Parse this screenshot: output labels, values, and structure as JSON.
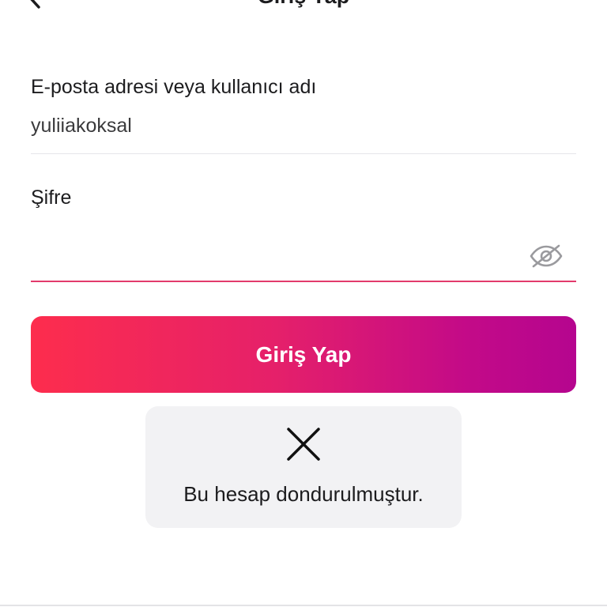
{
  "header": {
    "title": "Giriş Yap",
    "back_icon": "chevron-left-icon"
  },
  "form": {
    "email_label": "E-posta adresi veya kullanıcı adı",
    "email_value": "yuliiakoksal",
    "password_label": "Şifre",
    "password_value": "",
    "password_toggle_icon": "eye-slash-icon"
  },
  "login_button": {
    "label": "Giriş Yap",
    "gradient_start": "#fd2d4d",
    "gradient_end": "#b5058f"
  },
  "toast": {
    "icon": "close-icon",
    "message": "Bu hesap dondurulmuştur."
  },
  "colors": {
    "accent": "#e23a6c",
    "toast_bg": "#f2f2f4"
  }
}
